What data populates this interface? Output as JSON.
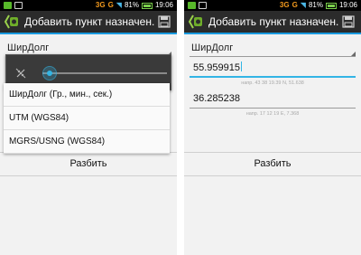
{
  "status_bar": {
    "network_3g": "3G",
    "network_g": "G",
    "battery_pct": "81%",
    "time": "19:06"
  },
  "action_bar": {
    "title": "Добавить пункт назначен..."
  },
  "left_panel": {
    "format_spinner": {
      "selected": "ШирДолг"
    },
    "format_options": [
      "ШирДолг (Гр., мин., сек.)",
      "UTM (WGS84)",
      "MGRS/USNG (WGS84)"
    ],
    "split_label": "Разбить"
  },
  "right_panel": {
    "format_spinner": {
      "selected": "ШирДолг"
    },
    "latitude": {
      "value": "55.959915",
      "hint": "напр. 43 38 19.39 N, 51.638"
    },
    "longitude": {
      "value": "36.285238",
      "hint": "напр. 17 12 19 E, 7.368"
    },
    "split_label": "Разбить"
  },
  "colors": {
    "accent": "#33b5e5",
    "action_bar": "#2b2b2b",
    "status_bar": "#000000"
  }
}
